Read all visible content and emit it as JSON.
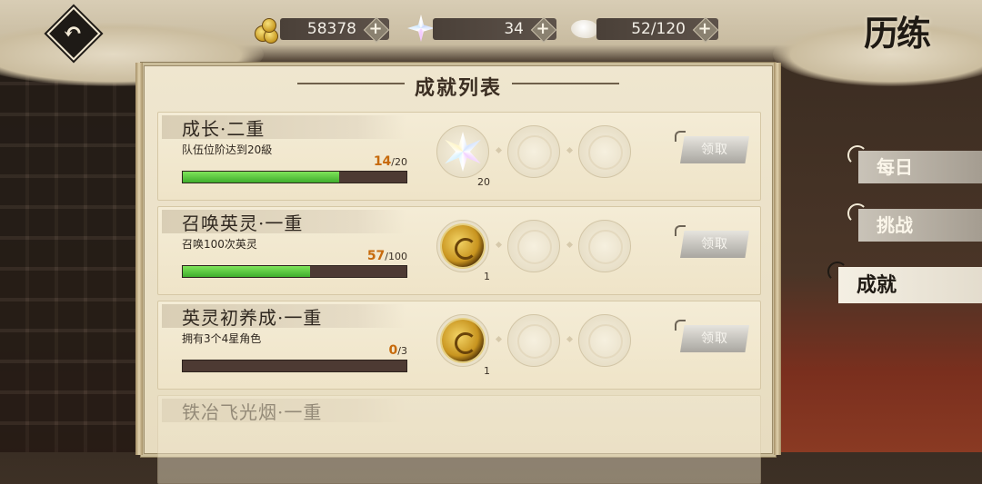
{
  "header": {
    "title": "历练",
    "resources": [
      {
        "icon": "gold-coins-icon",
        "value": "58378"
      },
      {
        "icon": "crystal-star-icon",
        "value": "34"
      },
      {
        "icon": "bread-stamina-icon",
        "value": "52/120"
      }
    ]
  },
  "panel": {
    "title": "成就列表",
    "achievements": [
      {
        "name": "成长·二重",
        "desc": "队伍位阶达到20級",
        "current": "14",
        "total": "/20",
        "progress": 0.7,
        "reward_icon": "crystal-star-icon",
        "reward_count": "20",
        "claim_label": "领取"
      },
      {
        "name": "召唤英灵·一重",
        "desc": "召唤100次英灵",
        "current": "57",
        "total": "/100",
        "progress": 0.57,
        "reward_icon": "gold-medal-icon",
        "reward_count": "1",
        "claim_label": "领取"
      },
      {
        "name": "英灵初养成·一重",
        "desc": "拥有3个4星角色",
        "current": "0",
        "total": "/3",
        "progress": 0.0,
        "reward_icon": "gold-medal-icon",
        "reward_count": "1",
        "claim_label": "领取"
      },
      {
        "name": "铁冶飞光烟·一重"
      }
    ]
  },
  "tabs": [
    {
      "label": "每日",
      "active": false
    },
    {
      "label": "挑战",
      "active": false
    },
    {
      "label": "成就",
      "active": true
    }
  ]
}
